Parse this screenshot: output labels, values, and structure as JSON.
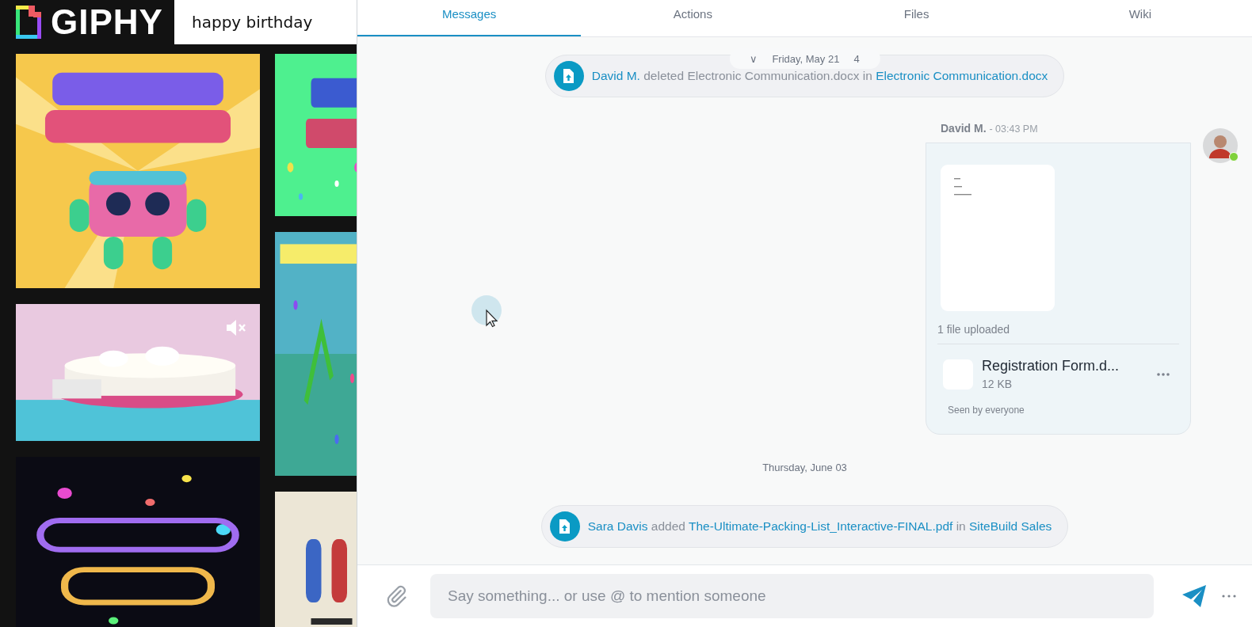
{
  "giphy": {
    "logo": "GIPHY",
    "search": {
      "value": "happy birthday"
    },
    "columns": [
      [
        {
          "kind": "picture",
          "muted": false
        },
        {
          "kind": "picture",
          "muted": true
        },
        {
          "kind": "picture",
          "muted": false
        }
      ],
      [
        {
          "kind": "picture",
          "muted": false
        },
        {
          "kind": "picture",
          "muted": false
        },
        {
          "kind": "picture",
          "muted": false
        }
      ]
    ]
  },
  "tabs": [
    {
      "label": "Messages",
      "selected": true
    },
    {
      "label": "Actions",
      "selected": false
    },
    {
      "label": "Files",
      "selected": false
    },
    {
      "label": "Wiki",
      "selected": false
    }
  ],
  "messages": [
    {
      "kind": "activity",
      "sticky_date": {
        "chevron": "∨",
        "label": "Friday, May 21",
        "trailing": "4"
      },
      "segments": [
        {
          "text": "David M.",
          "kind": "link"
        },
        {
          "text": "deleted Electronic Communication.docx in",
          "kind": "plain"
        },
        {
          "text": "Electronic Communication.docx",
          "kind": "link"
        }
      ]
    },
    {
      "kind": "file_message",
      "sender": "David M.",
      "time": "- 03:43 PM",
      "online": true,
      "summary": "1 file uploaded",
      "file": {
        "name": "Registration Form.d...",
        "size": "12 KB"
      },
      "seen": "Seen by everyone"
    },
    {
      "kind": "date",
      "label": "Thursday, June 03"
    },
    {
      "kind": "activity",
      "segments": [
        {
          "text": "Sara Davis",
          "kind": "link"
        },
        {
          "text": "added",
          "kind": "plain"
        },
        {
          "text": "The-Ultimate-Packing-List_Interactive-FINAL.pdf",
          "kind": "link"
        },
        {
          "text": "in",
          "kind": "plain"
        },
        {
          "text": "SiteBuild Sales",
          "kind": "link"
        }
      ]
    }
  ],
  "composer": {
    "placeholder": "Say something... or use @ to mention someone"
  }
}
